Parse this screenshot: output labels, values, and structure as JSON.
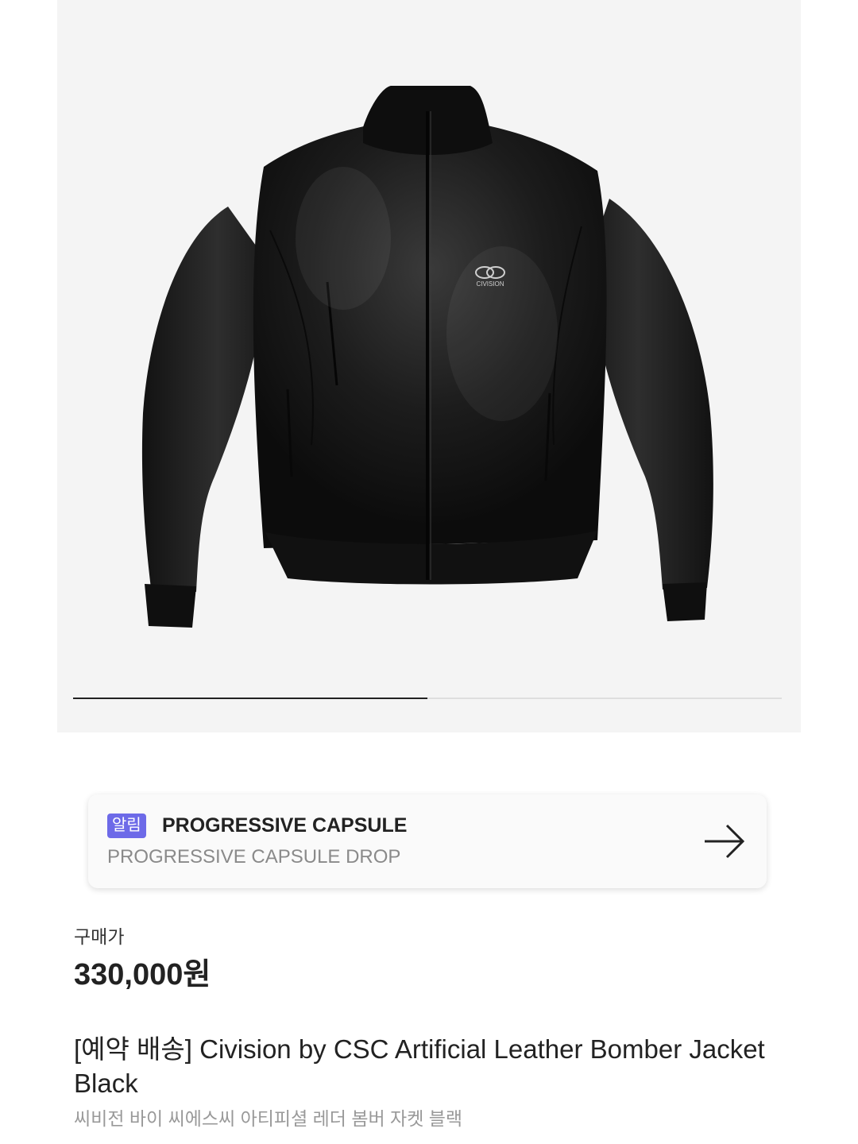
{
  "gallery": {
    "image_alt": "Civision black leather bomber jacket",
    "logo_text": "CIVISION",
    "slide_index": 1,
    "slide_count": 2
  },
  "notice": {
    "badge": "알림",
    "title": "PROGRESSIVE CAPSULE",
    "subtitle": "PROGRESSIVE CAPSULE DROP"
  },
  "price": {
    "label": "구매가",
    "value": "330,000원"
  },
  "product": {
    "name": "[예약 배송] Civision by CSC Artificial Leather Bomber Jacket Black",
    "name_ko": "씨비전 바이 씨에스씨 아티피셜 레더 봄버 자켓 블랙"
  },
  "colors": {
    "badge": "#6d6ae8",
    "gallery_bg": "#f4f4f4"
  }
}
